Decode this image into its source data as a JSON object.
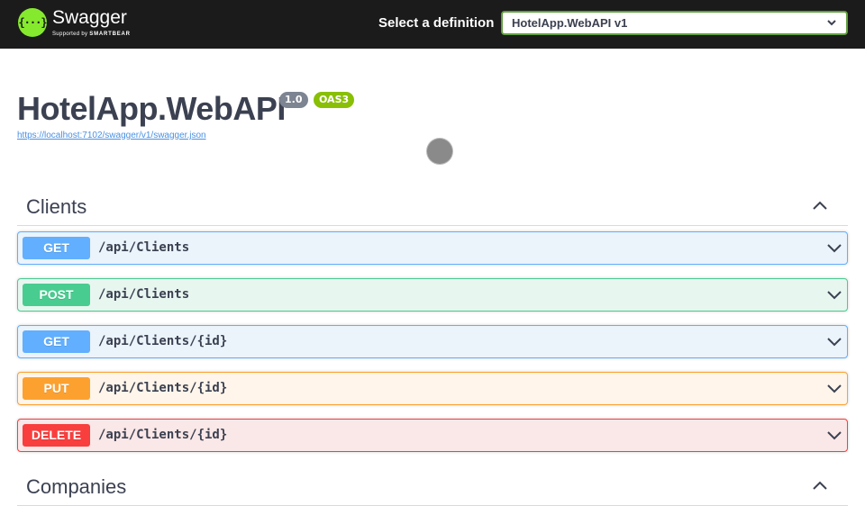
{
  "topbar": {
    "logo_mark": "{···}",
    "logo_name": "Swagger",
    "logo_supported": "Supported by",
    "logo_company": "SMARTBEAR",
    "definition_label": "Select a definition",
    "definition_value": "HotelApp.WebAPI v1"
  },
  "info": {
    "title": "HotelApp.WebAPI",
    "version": "1.0",
    "spec": "OAS3",
    "spec_url": "https://localhost:7102/swagger/v1/swagger.json"
  },
  "tags": [
    {
      "name": "Clients",
      "operations": [
        {
          "method": "GET",
          "path": "/api/Clients"
        },
        {
          "method": "POST",
          "path": "/api/Clients"
        },
        {
          "method": "GET",
          "path": "/api/Clients/{id}"
        },
        {
          "method": "PUT",
          "path": "/api/Clients/{id}"
        },
        {
          "method": "DELETE",
          "path": "/api/Clients/{id}"
        }
      ]
    },
    {
      "name": "Companies"
    }
  ],
  "colors": {
    "topbar": "#1b1b1b",
    "logo": "#85ea2d",
    "get": "#61affe",
    "post": "#49cc90",
    "put": "#fca130",
    "delete": "#f93e3e"
  },
  "icons": {
    "select_arrow": "chevron-down-icon",
    "tag_toggle": "chevron-up-icon",
    "op_expand": "chevron-down-icon",
    "loading": "loading-spinner"
  }
}
